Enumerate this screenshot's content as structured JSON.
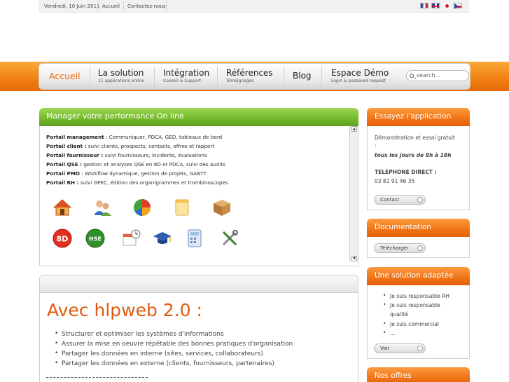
{
  "topbar": {
    "date": "Vendredi, 10 Juin 2011",
    "home": "Accueil",
    "contact": "Contactez-nous",
    "flags": [
      "flag-fr-icon",
      "flag-uk-icon",
      "flag-jp-icon",
      "flag-cz-icon"
    ]
  },
  "nav": {
    "items": [
      {
        "label": "Accueil",
        "sub": ""
      },
      {
        "label": "La solution",
        "sub": "11 applications online"
      },
      {
        "label": "Intégration",
        "sub": "Conseil & Support"
      },
      {
        "label": "Références",
        "sub": "Témoignages"
      },
      {
        "label": "Blog",
        "sub": ""
      },
      {
        "label": "Espace Démo",
        "sub": "Login & password request"
      }
    ],
    "search_placeholder": "search..."
  },
  "left_panel": {
    "title": "Manager votre performance On line",
    "portails": [
      {
        "name": "Portail management",
        "desc": " : Communiquer, PDCA, GED, tableaux de bord"
      },
      {
        "name": "Portail client :",
        "desc": " suivi clients, prospects, contacts, offres et rapport"
      },
      {
        "name": "Portail fournisseur :",
        "desc": " suivi fournisseurs, incidents, évaluations"
      },
      {
        "name": "Portail QSE :",
        "desc": " gestion et analyses QSE en 8D et PDCA, suivi des audits"
      },
      {
        "name": "Portail PMO",
        "desc": " : Workflow dynamique, gestion de projets, GANTT"
      },
      {
        "name": "Portail RH :",
        "desc": " suivi GPEC, édition des organigrammes et trombinoscopes"
      }
    ],
    "icon_8d": "8D",
    "icon_hse": "HSE"
  },
  "main": {
    "title": "Avec hlpweb 2.0 :",
    "bullets": [
      "Structurer et optimiser les systèmes d'informations",
      "Assurer la mise en oeuvre répétable des bonnes pratiques d'organisation",
      "Partager les données en interne (sites, services, collaborateurs)",
      "Partager les données en externe (clients, fournisseurs, partenaires)"
    ]
  },
  "sidebar": {
    "essai": {
      "title": "Essayez l'application",
      "line1": "Démonstration et essai  gratuit",
      "line2": ":",
      "line3": "tous les jours de 8h à 18h",
      "phone_label": "TELEPHONE DIRECT :",
      "phone": "03 81 91 46 35",
      "button": "Contact"
    },
    "doc": {
      "title": "Documentation",
      "button": "Télécharger"
    },
    "solution": {
      "title": "Une solution adaptée",
      "items": [
        "Je suis responsable RH",
        "Je suis responsable",
        "qualité",
        "Je suis commercial",
        "..."
      ],
      "button": "Voir"
    },
    "offres": {
      "title": "Nos offres"
    }
  },
  "colors": {
    "orange": "#f07316",
    "green": "#74b82c",
    "title_orange": "#e05a10"
  }
}
